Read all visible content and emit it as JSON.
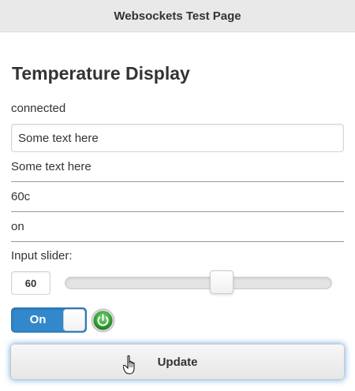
{
  "header": {
    "title": "Websockets Test Page"
  },
  "main": {
    "title": "Temperature Display",
    "status": "connected",
    "text_input": {
      "value": "Some text here"
    },
    "values": [
      "Some text here",
      "60c",
      "on"
    ],
    "slider": {
      "label": "Input slider:",
      "value": "60",
      "min": 0,
      "max": 100,
      "fraction": 0.6
    },
    "switch": {
      "label": "On",
      "state": "on",
      "accent_color": "#3388cc"
    },
    "power_indicator": {
      "icon": "power-icon",
      "color": "#3aa63a"
    },
    "update_button": {
      "label": "Update"
    }
  },
  "cursor": {
    "icon": "hand-pointer-icon"
  }
}
